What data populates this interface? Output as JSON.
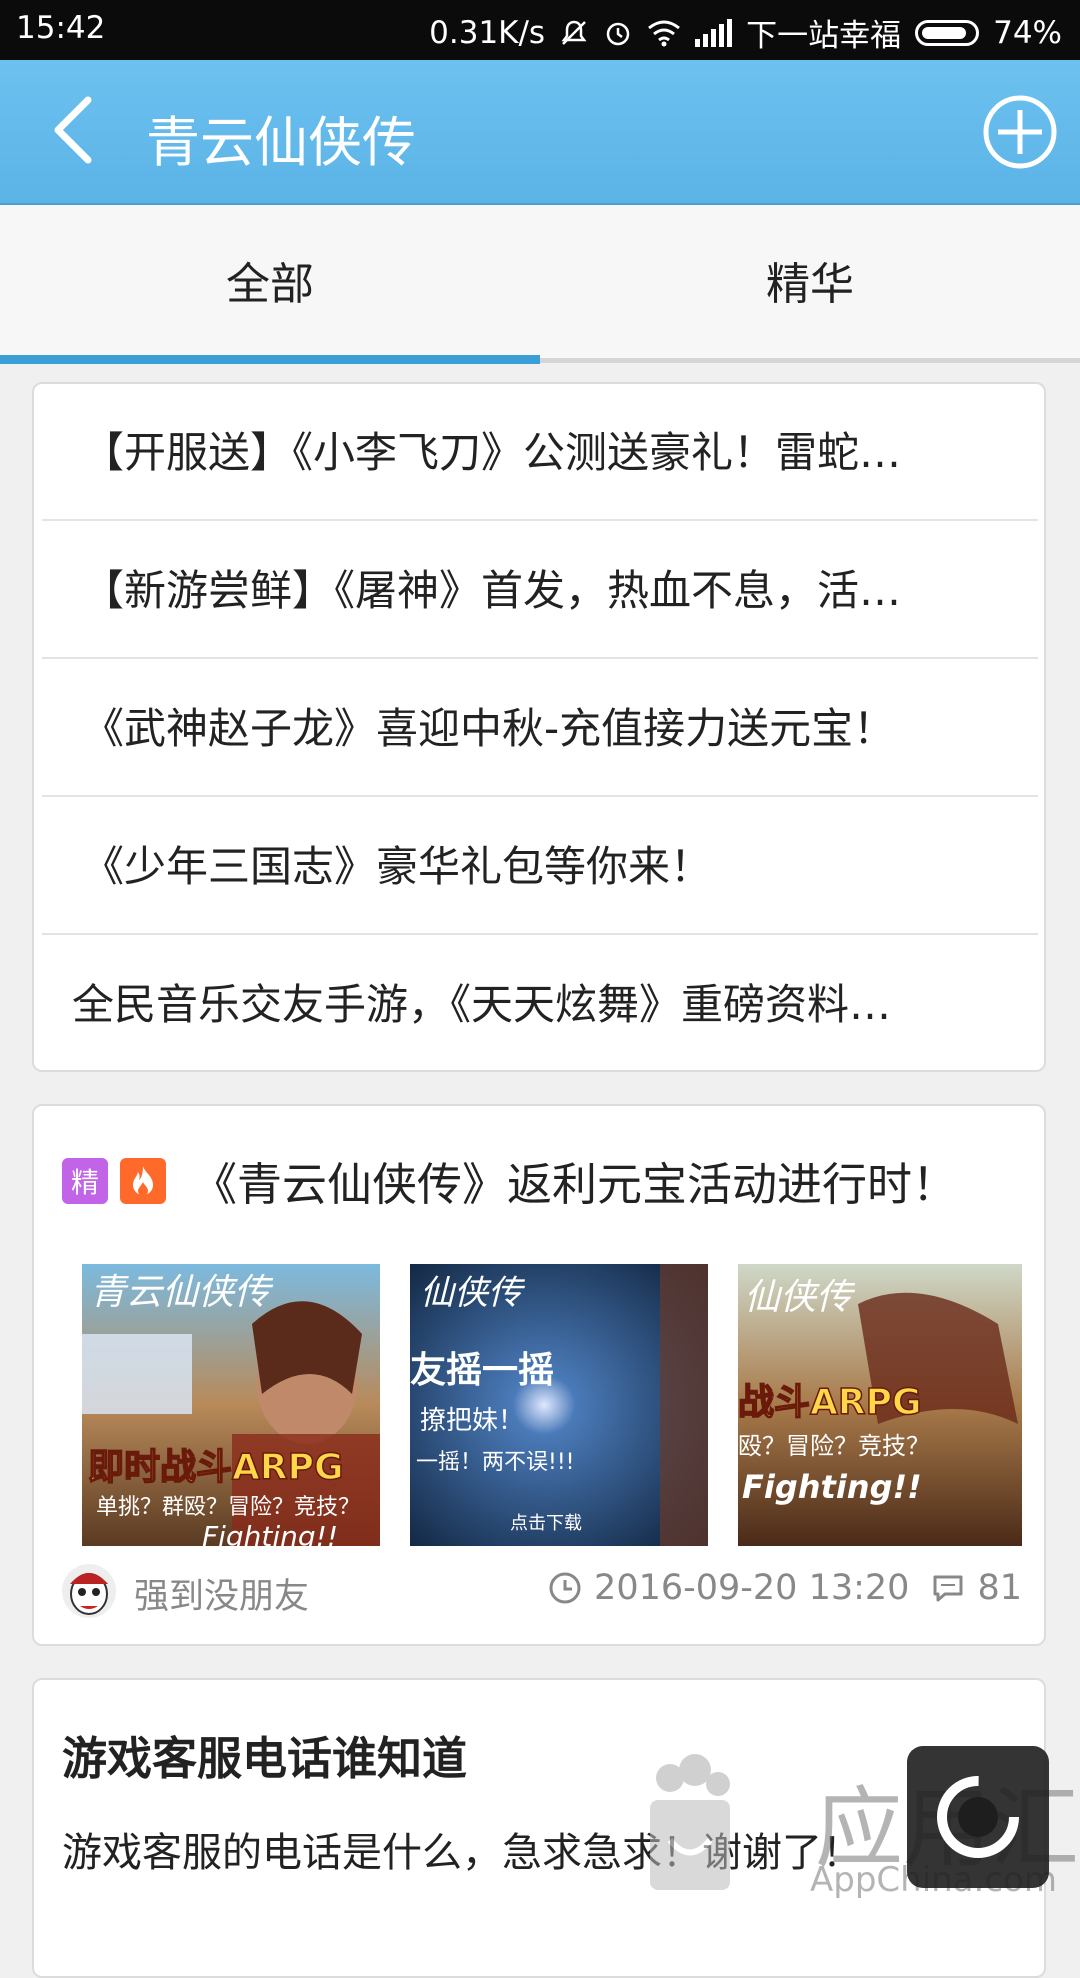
{
  "status_bar": {
    "time": "15:42",
    "net_speed": "0.31K/s",
    "carrier": "下一站幸福",
    "battery": "74%"
  },
  "header": {
    "title": "青云仙侠传"
  },
  "tabs": [
    {
      "label": "全部",
      "active": true
    },
    {
      "label": "精华",
      "active": false
    }
  ],
  "notices": [
    "【开服送】《小李飞刀》公测送豪礼！雷蛇…",
    "【新游尝鲜】《屠神》首发，热血不息，活…",
    "《武神赵子龙》喜迎中秋-充值接力送元宝！",
    "《少年三国志》豪华礼包等你来！",
    "全民音乐交友手游，《天天炫舞》重磅资料…"
  ],
  "post": {
    "badge_essence": "精",
    "title": "《青云仙侠传》返利元宝活动进行时！",
    "thumbs": [
      {
        "top_text": "青云仙侠传",
        "mid_text": "即时战斗ARPG",
        "sub_text": "单挑？群殴？冒险？竞技？",
        "foot_text": "Fighting!!"
      },
      {
        "top_text": "仙侠传",
        "mid_text": "友摇一摇",
        "sub_text": "撩把妹！",
        "extra_text": "一摇！两不误!!!",
        "foot_text": "点击下载"
      },
      {
        "top_text": "仙侠传",
        "mid_text": "战斗ARPG",
        "sub_text": "殴？冒险？竞技？",
        "foot_text": "Fighting!!"
      }
    ],
    "author": "强到没朋友",
    "datetime": "2016-09-20 13:20",
    "comments": "81"
  },
  "qa": {
    "title": "游戏客服电话谁知道",
    "body": "游戏客服的电话是什么，急求急求！谢谢了！"
  },
  "watermark": {
    "text": "应用汇",
    "sub": "AppChina.com"
  },
  "colors": {
    "header": "#5bb3e6",
    "tab_indicator": "#3a9fd6",
    "badge_essence": "#c164e8",
    "badge_hot": "#ff6a2b"
  }
}
